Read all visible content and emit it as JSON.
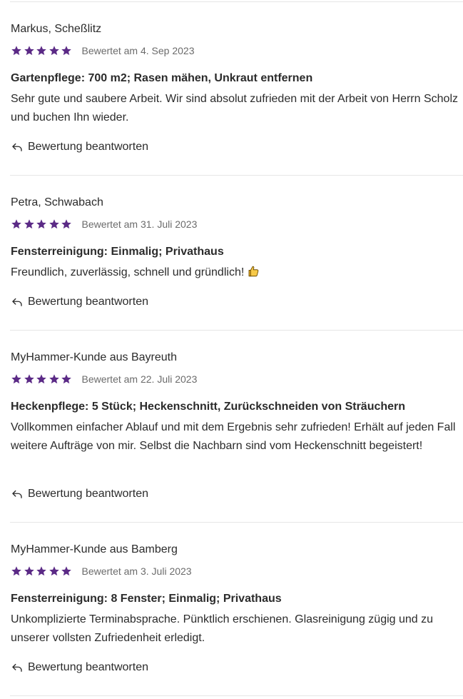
{
  "colors": {
    "star": "#5b2a86",
    "divider": "#e6e6e6",
    "text": "#2b2b2b",
    "muted": "#6b6b6b"
  },
  "reviews": [
    {
      "author": "Markus, Scheßlitz",
      "rating": 5,
      "rating_max": 5,
      "date": "Bewertet am 4. Sep 2023",
      "service": "Gartenpflege: 700 m2; Rasen mähen, Unkraut entfernen",
      "text": "Sehr gute und saubere Arbeit. Wir sind absolut zufrieden mit der Arbeit von Herrn Scholz und buchen Ihn wieder.",
      "reply_label": "Bewertung beantworten",
      "reply_icon": "reply-arrow-icon"
    },
    {
      "author": "Petra, Schwabach",
      "rating": 5,
      "rating_max": 5,
      "date": "Bewertet am 31. Juli 2023",
      "service": "Fensterreinigung: Einmalig; Privathaus",
      "text": "Freundlich, zuverlässig, schnell und gründlich!",
      "emoji": "thumbs-up-icon",
      "reply_label": "Bewertung beantworten",
      "reply_icon": "reply-arrow-icon"
    },
    {
      "author": "MyHammer-Kunde aus Bayreuth",
      "rating": 5,
      "rating_max": 5,
      "date": "Bewertet am 22. Juli 2023",
      "service": "Heckenpflege: 5 Stück; Heckenschnitt, Zurückschneiden von Sträuchern",
      "text": "Vollkommen einfacher Ablauf und mit dem Ergebnis sehr zufrieden! Erhält auf jeden Fall weitere Aufträge von mir. Selbst die Nachbarn sind vom Heckenschnitt begeistert!",
      "reply_label": "Bewertung beantworten",
      "reply_icon": "reply-arrow-icon"
    },
    {
      "author": "MyHammer-Kunde aus Bamberg",
      "rating": 5,
      "rating_max": 5,
      "date": "Bewertet am 3. Juli 2023",
      "service": "Fensterreinigung: 8 Fenster; Einmalig; Privathaus",
      "text": "Unkomplizierte Terminabsprache. Pünktlich erschienen. Glasreinigung zügig und zu unserer vollsten Zufriedenheit erledigt.",
      "reply_label": "Bewertung beantworten",
      "reply_icon": "reply-arrow-icon"
    }
  ]
}
